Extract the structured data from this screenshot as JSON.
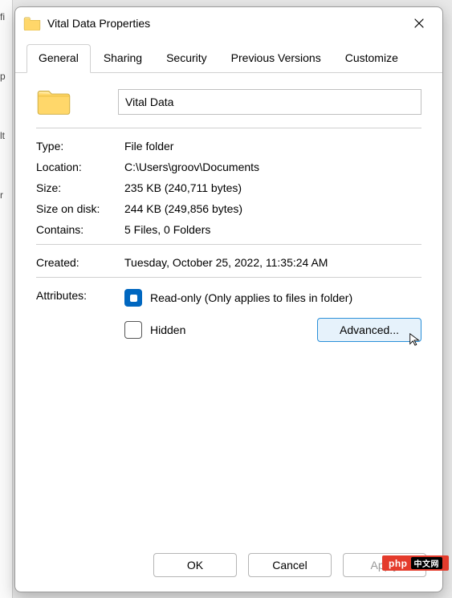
{
  "sideMarkers": [
    "fi",
    "p",
    "lt",
    "r"
  ],
  "titlebar": {
    "title": "Vital Data Properties"
  },
  "tabs": [
    {
      "label": "General",
      "active": true
    },
    {
      "label": "Sharing"
    },
    {
      "label": "Security"
    },
    {
      "label": "Previous Versions"
    },
    {
      "label": "Customize"
    }
  ],
  "folder": {
    "name": "Vital Data"
  },
  "info": {
    "type": {
      "label": "Type:",
      "value": "File folder"
    },
    "location": {
      "label": "Location:",
      "value": "C:\\Users\\groov\\Documents"
    },
    "size": {
      "label": "Size:",
      "value": "235 KB (240,711 bytes)"
    },
    "sizeOnDisk": {
      "label": "Size on disk:",
      "value": "244 KB (249,856 bytes)"
    },
    "contains": {
      "label": "Contains:",
      "value": "5 Files, 0 Folders"
    },
    "created": {
      "label": "Created:",
      "value": "Tuesday, October 25, 2022, 11:35:24 AM"
    }
  },
  "attributes": {
    "label": "Attributes:",
    "readonly": {
      "label": "Read-only (Only applies to files in folder)",
      "state": "indeterminate"
    },
    "hidden": {
      "label": "Hidden",
      "state": "unchecked"
    },
    "advanced": "Advanced..."
  },
  "buttons": {
    "ok": "OK",
    "cancel": "Cancel",
    "apply": "Apply"
  },
  "watermark": {
    "brand": "php",
    "suffix": "中文网"
  }
}
